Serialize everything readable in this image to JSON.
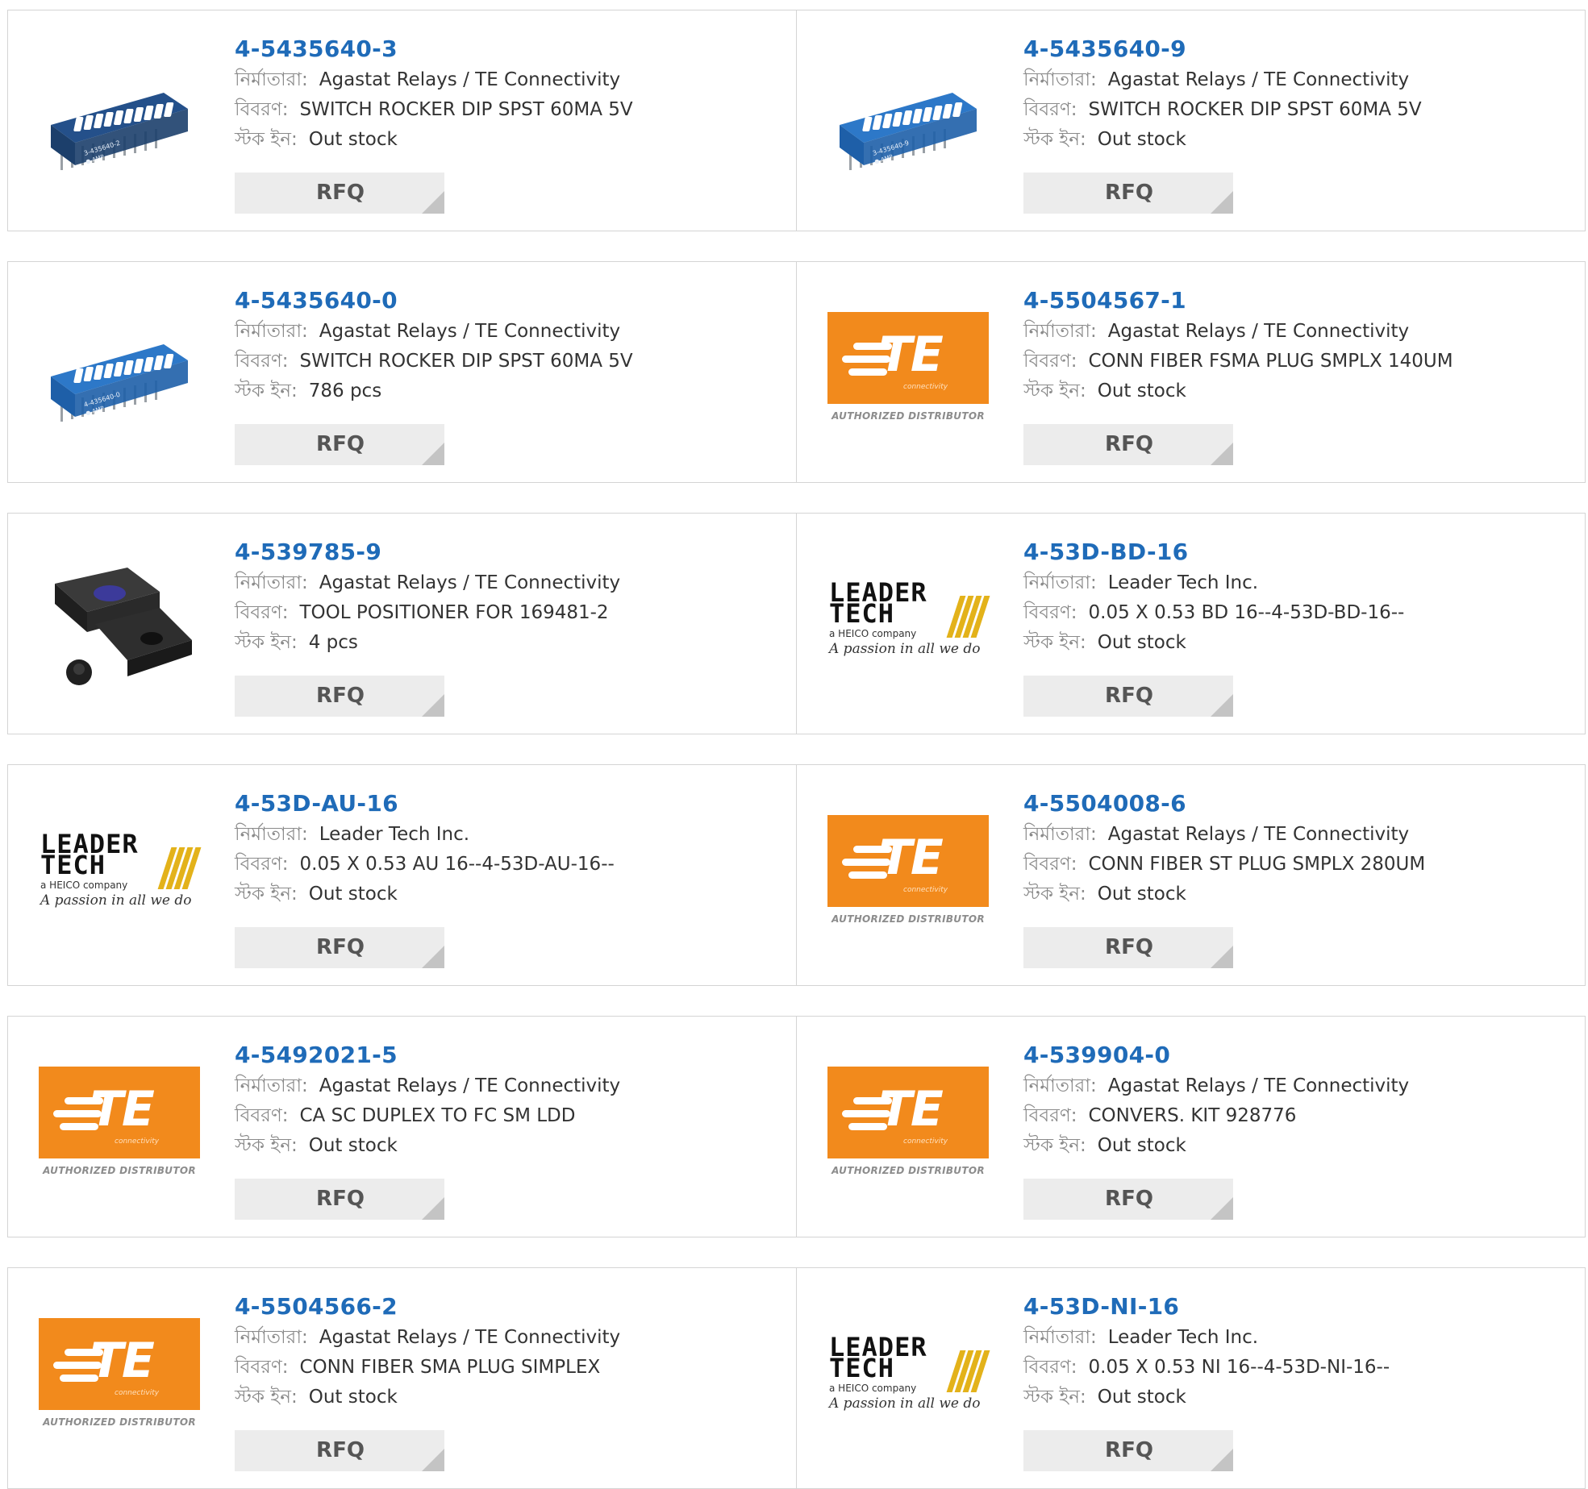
{
  "labels": {
    "manufacturer": "নির্মাতারা:",
    "description": "বিবরণ:",
    "stock": "স্টক ইন:",
    "rfq": "RFQ"
  },
  "logos": {
    "te_word": "TE",
    "te_sub": "connectivity",
    "te_dist": "AUTHORIZED DISTRIBUTOR",
    "lt_line1": "LEADER",
    "lt_line2": "TECH",
    "lt_sub": "a HEICO company",
    "lt_tag": "A passion in all we do"
  },
  "colors": {
    "link": "#1f6bb8",
    "te_orange": "#f28a1c",
    "dip_blue": "#1e5fa8",
    "lt_yellow": "#e3b21a"
  },
  "products": [
    {
      "part": "4-5435640-3",
      "manufacturer": "Agastat Relays / TE Connectivity",
      "description": "SWITCH ROCKER DIP SPST 60MA 5V",
      "stock": "Out stock",
      "image": "dip-switch-dark",
      "chip_text": "3-435640-2"
    },
    {
      "part": "4-5435640-9",
      "manufacturer": "Agastat Relays / TE Connectivity",
      "description": "SWITCH ROCKER DIP SPST 60MA 5V",
      "stock": "Out stock",
      "image": "dip-switch-blue",
      "chip_text": "3-435640-9"
    },
    {
      "part": "4-5435640-0",
      "manufacturer": "Agastat Relays / TE Connectivity",
      "description": "SWITCH ROCKER DIP SPST 60MA 5V",
      "stock": "786 pcs",
      "image": "dip-switch-blue",
      "chip_text": "4-435640-0"
    },
    {
      "part": "4-5504567-1",
      "manufacturer": "Agastat Relays / TE Connectivity",
      "description": "CONN FIBER FSMA PLUG SMPLX 140UM",
      "stock": "Out stock",
      "image": "te-logo"
    },
    {
      "part": "4-539785-9",
      "manufacturer": "Agastat Relays / TE Connectivity",
      "description": "TOOL POSITIONER FOR 169481-2",
      "stock": "4 pcs",
      "image": "tool-positioner"
    },
    {
      "part": "4-53D-BD-16",
      "manufacturer": "Leader Tech Inc.",
      "description": "0.05 X 0.53 BD 16--4-53D-BD-16--",
      "stock": "Out stock",
      "image": "leader-tech-logo"
    },
    {
      "part": "4-53D-AU-16",
      "manufacturer": "Leader Tech Inc.",
      "description": "0.05 X 0.53 AU 16--4-53D-AU-16--",
      "stock": "Out stock",
      "image": "leader-tech-logo"
    },
    {
      "part": "4-5504008-6",
      "manufacturer": "Agastat Relays / TE Connectivity",
      "description": "CONN FIBER ST PLUG SMPLX 280UM",
      "stock": "Out stock",
      "image": "te-logo"
    },
    {
      "part": "4-5492021-5",
      "manufacturer": "Agastat Relays / TE Connectivity",
      "description": "CA SC DUPLEX TO FC SM LDD",
      "stock": "Out stock",
      "image": "te-logo"
    },
    {
      "part": "4-539904-0",
      "manufacturer": "Agastat Relays / TE Connectivity",
      "description": "CONVERS. KIT 928776",
      "stock": "Out stock",
      "image": "te-logo"
    },
    {
      "part": "4-5504566-2",
      "manufacturer": "Agastat Relays / TE Connectivity",
      "description": "CONN FIBER SMA PLUG SIMPLEX",
      "stock": "Out stock",
      "image": "te-logo"
    },
    {
      "part": "4-53D-NI-16",
      "manufacturer": "Leader Tech Inc.",
      "description": "0.05 X 0.53 NI 16--4-53D-NI-16--",
      "stock": "Out stock",
      "image": "leader-tech-logo"
    }
  ]
}
